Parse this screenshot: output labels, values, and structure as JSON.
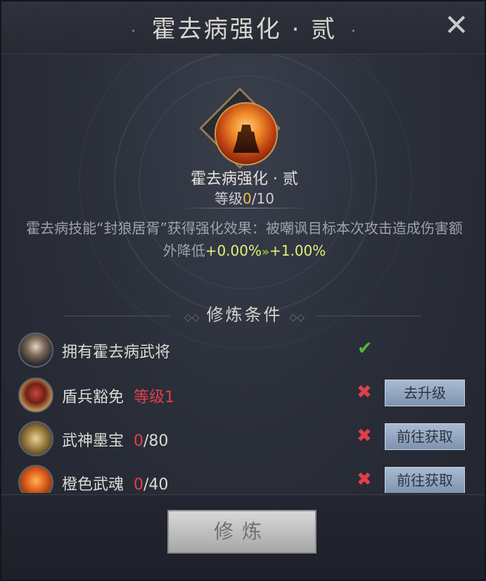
{
  "window": {
    "title": "霍去病强化 · 贰",
    "title_dot": "·"
  },
  "skill": {
    "name": "霍去病强化 · 贰",
    "level_label": "等级",
    "level_current": "0",
    "level_max": "/10"
  },
  "description": {
    "text": "霍去病技能“封狼居胥”获得强化效果：被嘲讽目标本次攻击造成伤害额外降低",
    "current_value": "+0.00%",
    "arrow": "»",
    "next_value": "+1.00%"
  },
  "conditions": {
    "header": "修炼条件",
    "items": [
      {
        "icon": "general-portrait-icon",
        "label": "拥有霍去病武将",
        "req": "",
        "progress": "",
        "status": "met",
        "button": ""
      },
      {
        "icon": "shield-soldier-icon",
        "label": "盾兵豁免",
        "req": "等级1",
        "progress": "",
        "status": "unmet",
        "button": "去升级"
      },
      {
        "icon": "martial-book-icon",
        "label": "武神墨宝",
        "req": "0",
        "progress": "/80",
        "status": "unmet",
        "button": "前往获取"
      },
      {
        "icon": "orange-soul-icon",
        "label": "橙色武魂",
        "req": "0",
        "progress": "/40",
        "status": "unmet",
        "button": "前往获取"
      }
    ]
  },
  "footer": {
    "train_button": "修炼"
  },
  "colors": {
    "highlight": "#f0c24a",
    "value_green": "#dff07a",
    "unmet_red": "#e0404a",
    "met_green": "#4fb83a"
  },
  "icons": {
    "close": "close-icon",
    "check": "check-icon",
    "cross": "cross-icon"
  }
}
